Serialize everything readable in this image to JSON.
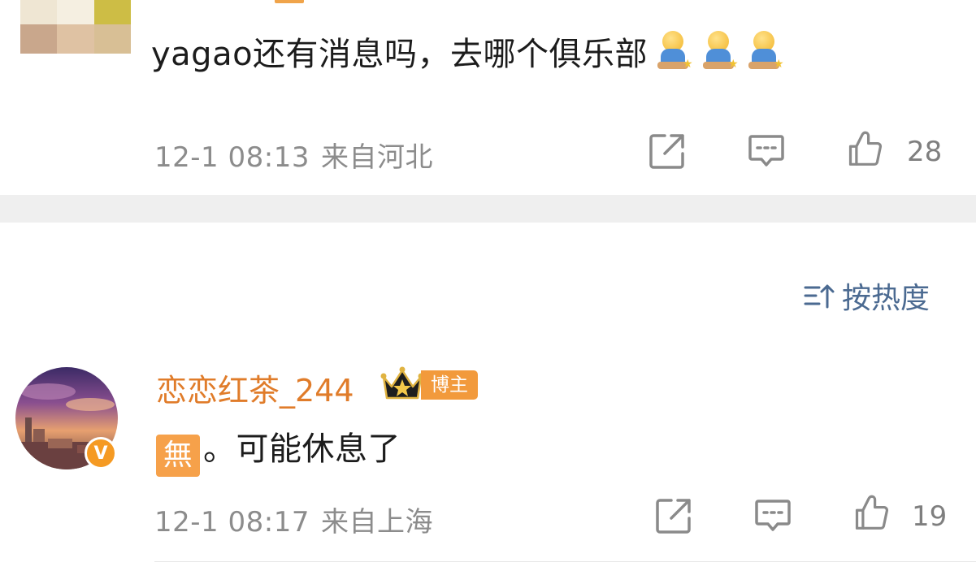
{
  "comment_prev": {
    "text": "yagao还有消息吗，去哪个俱乐部",
    "emojis": [
      "shy-emoji",
      "shy-emoji",
      "shy-emoji"
    ],
    "time": "12-1 08:13",
    "location": "来自河北",
    "likes": "28"
  },
  "sort": {
    "label": "按热度"
  },
  "comment": {
    "username": "恋恋红茶_244",
    "tag": "博主",
    "prefix_char": "無",
    "text": "。可能休息了",
    "time": "12-1 08:17",
    "location": "来自上海",
    "likes": "19"
  },
  "colors": {
    "username": "#e07c2a",
    "sort": "#4b6a91",
    "meta": "#8c8c8c",
    "badge": "#f29a3c",
    "divider": "#efefef"
  }
}
